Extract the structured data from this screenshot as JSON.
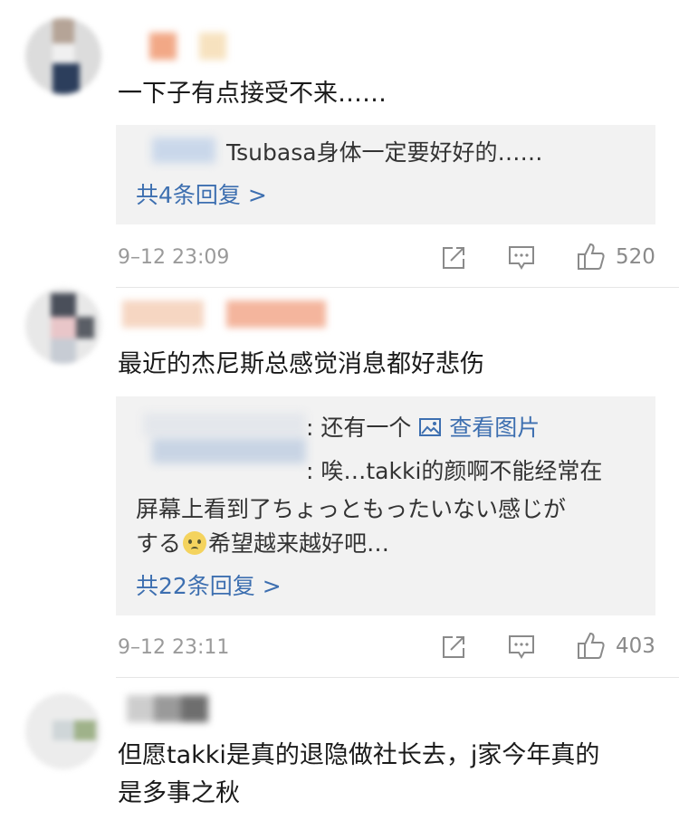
{
  "comments": [
    {
      "text": "一下子有点接受不来……",
      "reply": {
        "line1": "Tsubasa身体一定要好好的……",
        "link": "共4条回复 >"
      },
      "time": "9–12 23:09",
      "likes": "520"
    },
    {
      "text": "最近的杰尼斯总感觉消息都好悲伤",
      "reply": {
        "line1_text": ": 还有一个 ",
        "line1_link": "查看图片",
        "line2": ": 唉…takki的颜啊不能经常在",
        "line3": "屏幕上看到了ちょっともったいない感じが",
        "line4_a": "する",
        "line4_b": "希望越来越好吧…",
        "link": "共22条回复 >"
      },
      "time": "9–12 23:11",
      "likes": "403"
    },
    {
      "text": "但愿takki是真的退隐做社长去，j家今年真的",
      "text2": "是多事之秋"
    }
  ],
  "icons": {
    "share": "share-icon",
    "comment": "comment-icon",
    "like": "thumbs-up-icon",
    "image": "image-icon",
    "emoji": "worried-face-emoji"
  },
  "colors": {
    "link": "#3d6fb0",
    "meta": "#9a9a9a",
    "reply_bg": "#f2f2f2"
  }
}
